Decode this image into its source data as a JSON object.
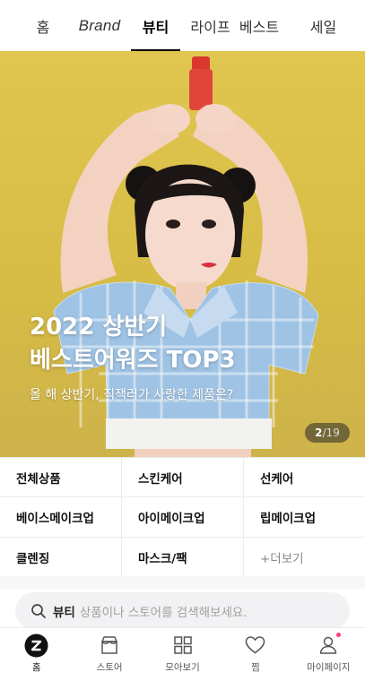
{
  "top_tabs": [
    {
      "label": "홈"
    },
    {
      "label": "Brand"
    },
    {
      "label": "뷰티"
    },
    {
      "label": "라이프"
    },
    {
      "label": "베스트"
    },
    {
      "label": "세일"
    }
  ],
  "active_tab": "뷰티",
  "hero": {
    "title_line1": "2022 상반기",
    "title_line2": "베스트어워즈 TOP3",
    "subtitle": "올 해 상반기, 직잭러가 사랑한 제품은?",
    "pager_current": "2",
    "pager_total": "/19"
  },
  "categories": [
    {
      "label": "전체상품"
    },
    {
      "label": "스킨케어"
    },
    {
      "label": "선케어"
    },
    {
      "label": "베이스메이크업"
    },
    {
      "label": "아이메이크업"
    },
    {
      "label": "립메이크업"
    },
    {
      "label": "클렌징"
    },
    {
      "label": "마스크/팩"
    },
    {
      "label": "+더보기"
    }
  ],
  "search": {
    "brand_label": "뷰티",
    "placeholder": "상품이나 스토어를 검색해보세요."
  },
  "bottom_nav": [
    {
      "label": "홈",
      "icon": "zigzag-logo-icon"
    },
    {
      "label": "스토어",
      "icon": "store-icon"
    },
    {
      "label": "모아보기",
      "icon": "grid-icon"
    },
    {
      "label": "찜",
      "icon": "heart-icon"
    },
    {
      "label": "마이페이지",
      "icon": "person-icon"
    }
  ],
  "colors": {
    "banner_background": "#d9be47",
    "notification_dot": "#ff3c78",
    "active_tab_underline": "#000000"
  }
}
